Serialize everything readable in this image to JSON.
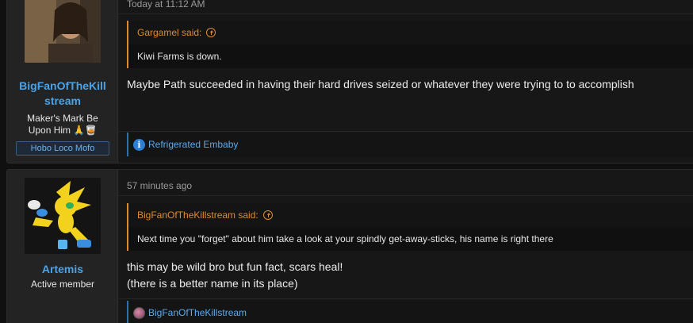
{
  "posts": [
    {
      "username_line1": "BigFanOfTheKill",
      "username_line2": "stream",
      "user_title_line1": "Maker's Mark Be",
      "user_title_line2": "Upon Him 🙏🥃",
      "user_banner": "Hobo Loco Mofo",
      "timestamp": "Today at 11:12 AM",
      "quote": {
        "author": "Gargamel said:",
        "text": "Kiwi Farms is down."
      },
      "message": "Maybe Path succeeded in having their hard drives seized or whatever they were trying to to accomplish",
      "reaction_user": "Refrigerated Embaby"
    },
    {
      "username": "Artemis",
      "user_title": "Active member",
      "timestamp": "57 minutes ago",
      "quote": {
        "author": "BigFanOfTheKillstream said:",
        "text": "Next time you \"forget\" about him take a look at your spindly get-away-sticks, his name is right there"
      },
      "message_line1": "this may be wild bro but fun fact, scars heal!",
      "message_line2": "(there is a better name in its place)",
      "reaction_user": "BigFanOfTheKillstream"
    }
  ],
  "colors": {
    "accent_link": "#4aa3e8",
    "quote_accent": "#e08a2b",
    "background": "#101010"
  }
}
